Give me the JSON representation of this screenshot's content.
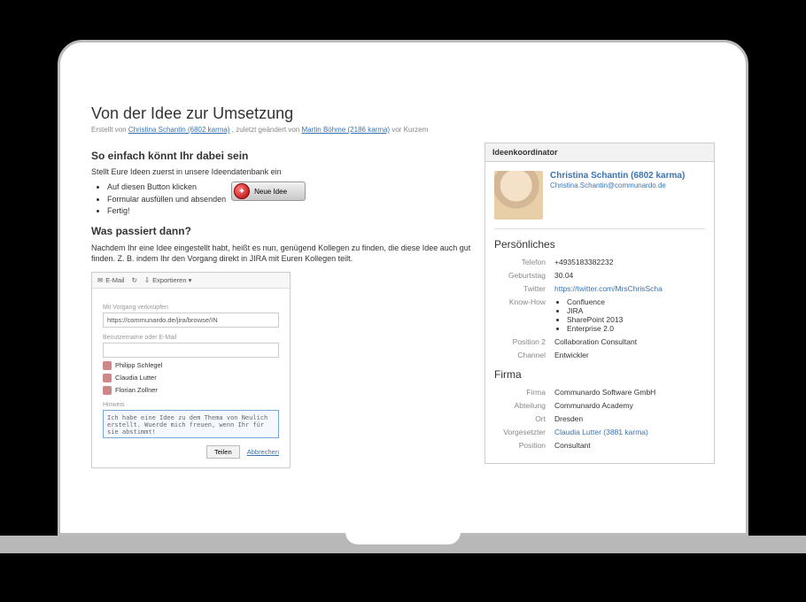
{
  "page": {
    "title": "Von der Idee zur Umsetzung",
    "meta_prefix": "Erstellt von",
    "meta_author": "Christina Schantin (6802 karma)",
    "meta_mid": ", zuletzt geändert von",
    "meta_editor": "Martin Böhme (2186 karma)",
    "meta_suffix": "vor Kurzem"
  },
  "main": {
    "section1_head": "So einfach könnt Ihr dabei sein",
    "intro": "Stellt Eure Ideen zuerst in unsere Ideendatenbank ein",
    "bullets": [
      "Auf diesen Button klicken",
      "Formular ausfüllen und absenden",
      "Fertig!"
    ],
    "new_idea_label": "Neue Idee",
    "section2_head": "Was passiert dann?",
    "body2": "Nachdem Ihr eine Idee eingestellt habt, heißt es nun, genügend Kollegen zu finden, die diese Idee auch gut finden. Z. B. indem Ihr den Vorgang direkt in JIRA mit Euren Kollegen teilt."
  },
  "share": {
    "tabs": [
      "E-Mail",
      "↻",
      "Exportieren ▾"
    ],
    "link_label": "Mit Vorgang verknüpfen",
    "link_value": "https://communardo.de/jira/browse/IN",
    "user_label": "Benutzername oder E-Mail",
    "users": [
      "Philipp Schlegel",
      "Claudia Lutter",
      "Florian Zollner"
    ],
    "note_label": "Hinweis",
    "note_text": "Ich habe eine Idee zu dem Thema von Neulich erstellt. Wuerde mich freuen, wenn Ihr für sie abstimmt!",
    "submit": "Teilen",
    "cancel": "Abbrechen"
  },
  "sidebar": {
    "card_title": "Ideenkoordinator",
    "name": "Christina Schantin (6802 karma)",
    "email": "Christina.Schantin@communardo.de",
    "personal_head": "Persönliches",
    "firma_head": "Firma",
    "rows_personal": [
      {
        "label": "Telefon",
        "value": "+4935183382232"
      },
      {
        "label": "Geburtstag",
        "value": "30.04"
      },
      {
        "label": "Twitter",
        "value": "https://twitter.com/MrsChrisScha",
        "link": true
      },
      {
        "label": "Know-How",
        "list": [
          "Confluence",
          "JIRA",
          "SharePoint 2013",
          "Enterprise 2.0"
        ]
      },
      {
        "label": "Position 2",
        "value": "Collaboration Consultant"
      },
      {
        "label": "Channel",
        "value": "Entwickler"
      }
    ],
    "rows_firma": [
      {
        "label": "Firma",
        "value": "Communardo Software GmbH"
      },
      {
        "label": "Abteilung",
        "value": "Communardo Academy"
      },
      {
        "label": "Ort",
        "value": "Dresden"
      },
      {
        "label": "Vorgesetzter",
        "value": "Claudia Lutter (3881 karma)",
        "link": true
      },
      {
        "label": "Position",
        "value": "Consultant"
      }
    ]
  }
}
